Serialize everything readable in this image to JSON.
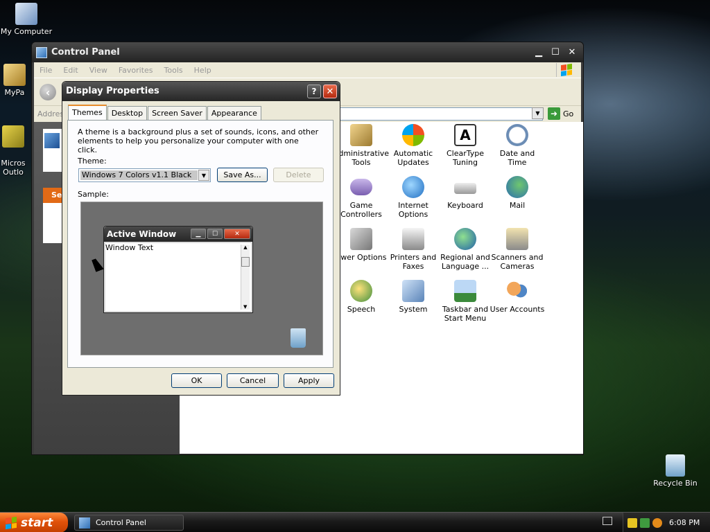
{
  "desktop": {
    "icons": [
      {
        "label": "My Computer"
      },
      {
        "label": "MyPa"
      },
      {
        "label": "Micros\nOutlo"
      },
      {
        "label": "Recycle Bin"
      }
    ]
  },
  "control_panel": {
    "title": "Control Panel",
    "menu": [
      "File",
      "Edit",
      "View",
      "Favorites",
      "Tools",
      "Help"
    ],
    "address_label": "Addres",
    "go_label": "Go",
    "task_header": "Se",
    "items": [
      {
        "label": "Administrative Tools",
        "icon": "admin-tools-icon"
      },
      {
        "label": "Automatic Updates",
        "icon": "automatic-updates-icon"
      },
      {
        "label": "ClearType Tuning",
        "icon": "cleartype-icon"
      },
      {
        "label": "Date and Time",
        "icon": "date-time-icon"
      },
      {
        "label": "Game Controllers",
        "icon": "game-controller-icon"
      },
      {
        "label": "Internet Options",
        "icon": "internet-options-icon"
      },
      {
        "label": "Keyboard",
        "icon": "keyboard-icon"
      },
      {
        "label": "Mail",
        "icon": "mail-icon"
      },
      {
        "label": "ower Options",
        "icon": "power-options-icon"
      },
      {
        "label": "Printers and Faxes",
        "icon": "printer-icon"
      },
      {
        "label": "Regional and Language ...",
        "icon": "globe-icon"
      },
      {
        "label": "Scanners and Cameras",
        "icon": "scanner-icon"
      },
      {
        "label": "Speech",
        "icon": "speech-icon"
      },
      {
        "label": "System",
        "icon": "system-icon"
      },
      {
        "label": "Taskbar and Start Menu",
        "icon": "taskbar-icon"
      },
      {
        "label": "User Accounts",
        "icon": "user-accounts-icon"
      }
    ]
  },
  "dialog": {
    "title": "Display Properties",
    "help": "?",
    "close": "✕",
    "tabs": [
      "Themes",
      "Desktop",
      "Screen Saver",
      "Appearance"
    ],
    "active_tab": "Themes",
    "description": "A theme is a background plus a set of sounds, icons, and other elements to help you personalize your computer with one click.",
    "theme_label": "Theme:",
    "theme_value": "Windows 7 Colors v1.1 Black",
    "save_as": "Save As...",
    "delete": "Delete",
    "sample_label": "Sample:",
    "sample_window_title": "Active Window",
    "sample_window_text": "Window Text",
    "ok": "OK",
    "cancel": "Cancel",
    "apply": "Apply"
  },
  "taskbar": {
    "start_label": "start",
    "task_label": "Control Panel",
    "clock": "6:08 PM"
  }
}
